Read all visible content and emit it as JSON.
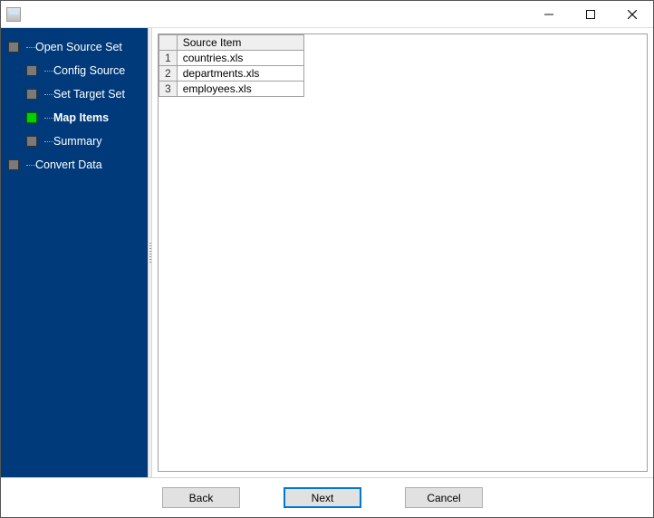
{
  "window": {
    "title": ""
  },
  "sidebar": {
    "items": [
      {
        "label": "Open Source Set",
        "level": 1,
        "current": false
      },
      {
        "label": "Config Source",
        "level": 2,
        "current": false
      },
      {
        "label": "Set Target Set",
        "level": 2,
        "current": false
      },
      {
        "label": "Map Items",
        "level": 2,
        "current": true
      },
      {
        "label": "Summary",
        "level": 2,
        "current": false
      },
      {
        "label": "Convert Data",
        "level": 1,
        "current": false
      }
    ]
  },
  "grid": {
    "header": "Source Item",
    "rows": [
      {
        "n": "1",
        "item": "countries.xls"
      },
      {
        "n": "2",
        "item": "departments.xls"
      },
      {
        "n": "3",
        "item": "employees.xls"
      }
    ]
  },
  "buttons": {
    "back": "Back",
    "next": "Next",
    "cancel": "Cancel"
  }
}
